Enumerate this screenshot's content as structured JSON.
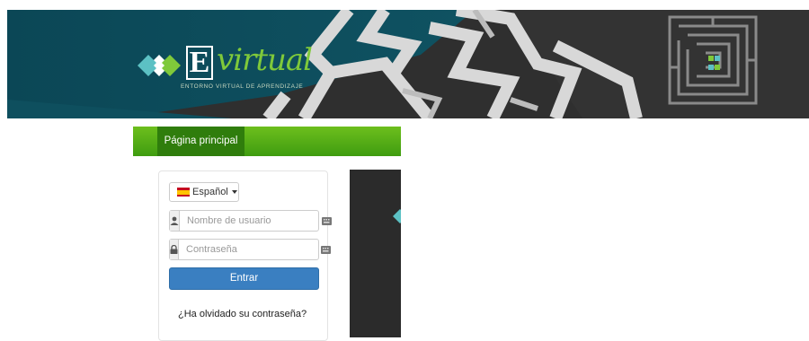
{
  "banner": {
    "logo_letter": "E",
    "logo_word": "virtual",
    "logo_subtitle": "ENTORNO VIRTUAL DE APRENDIZAJE",
    "colors": {
      "teal": "#0d4a5a",
      "dark": "#333333",
      "green": "#7fc93a",
      "cyan": "#5cc1c4"
    }
  },
  "nav": {
    "home_label": "Página principal"
  },
  "login": {
    "language": {
      "selected": "Español",
      "flag_icon": "spain-flag-icon"
    },
    "username": {
      "placeholder": "Nombre de usuario",
      "value": ""
    },
    "password": {
      "placeholder": "Contraseña",
      "value": ""
    },
    "submit_label": "Entrar",
    "forgot_label": "¿Ha olvidado su contraseña?",
    "colors": {
      "primary": "#3a7fc1"
    }
  }
}
